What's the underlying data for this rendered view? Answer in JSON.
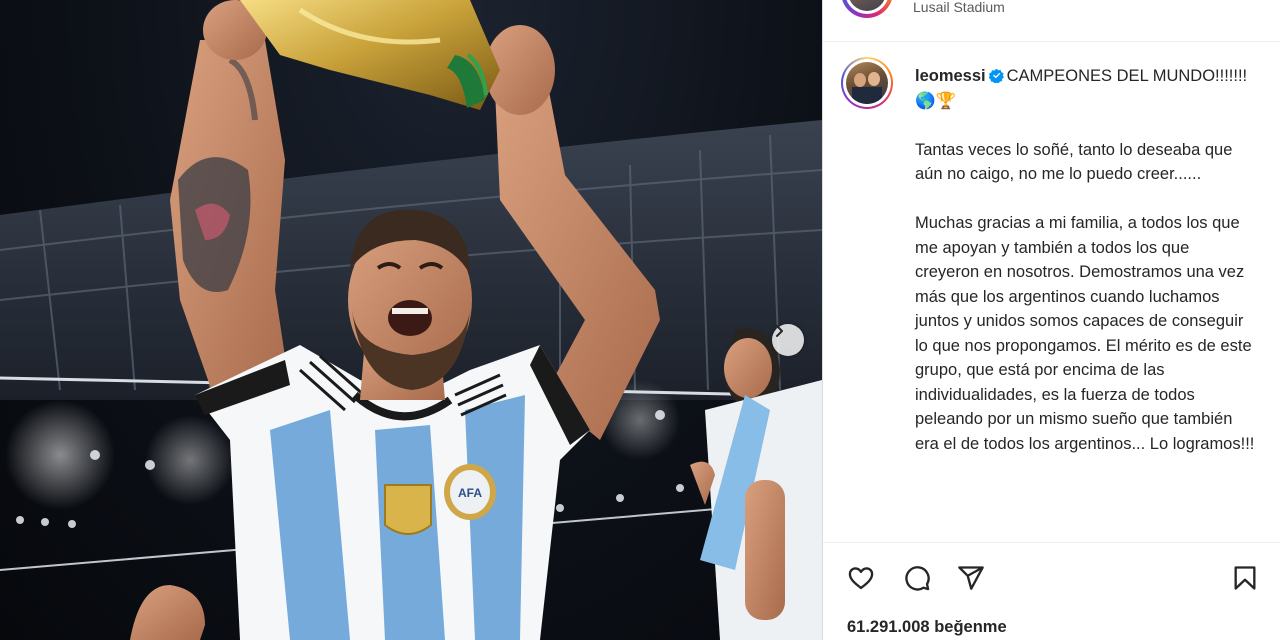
{
  "post": {
    "location": "Lusail Stadium",
    "username": "leomessi",
    "verified": true,
    "caption_title": "CAMPEONES DEL MUNDO!!!!!!!",
    "caption_emojis": "🌎🏆",
    "paragraphs": [
      "Tantas veces lo soñé, tanto lo deseaba que aún no caigo, no me lo puedo creer......",
      "Muchas gracias a mi familia, a todos los que me apoyan y también a todos los que creyeron en nosotros. Demostramos una vez más que los argentinos cuando luchamos juntos y unidos somos capaces de conseguir lo que nos propongamos. El mérito es de este grupo, que está por encima de las individualidades, es la fuerza de todos peleando por un mismo sueño que también era el de todos los argentinos... Lo logramos!!!"
    ],
    "likes_count": "61.291.008",
    "likes_label": "beğenme"
  },
  "photo": {
    "jersey_badge_text": "AFA"
  },
  "colors": {
    "verified_blue": "#0095f6",
    "jersey_blue": "#75aadb",
    "trophy_gold": "#c9a23a"
  },
  "icons": {
    "like": "heart-icon",
    "comment": "comment-icon",
    "share": "paper-plane-icon",
    "save": "bookmark-icon",
    "next": "chevron-right-icon"
  }
}
